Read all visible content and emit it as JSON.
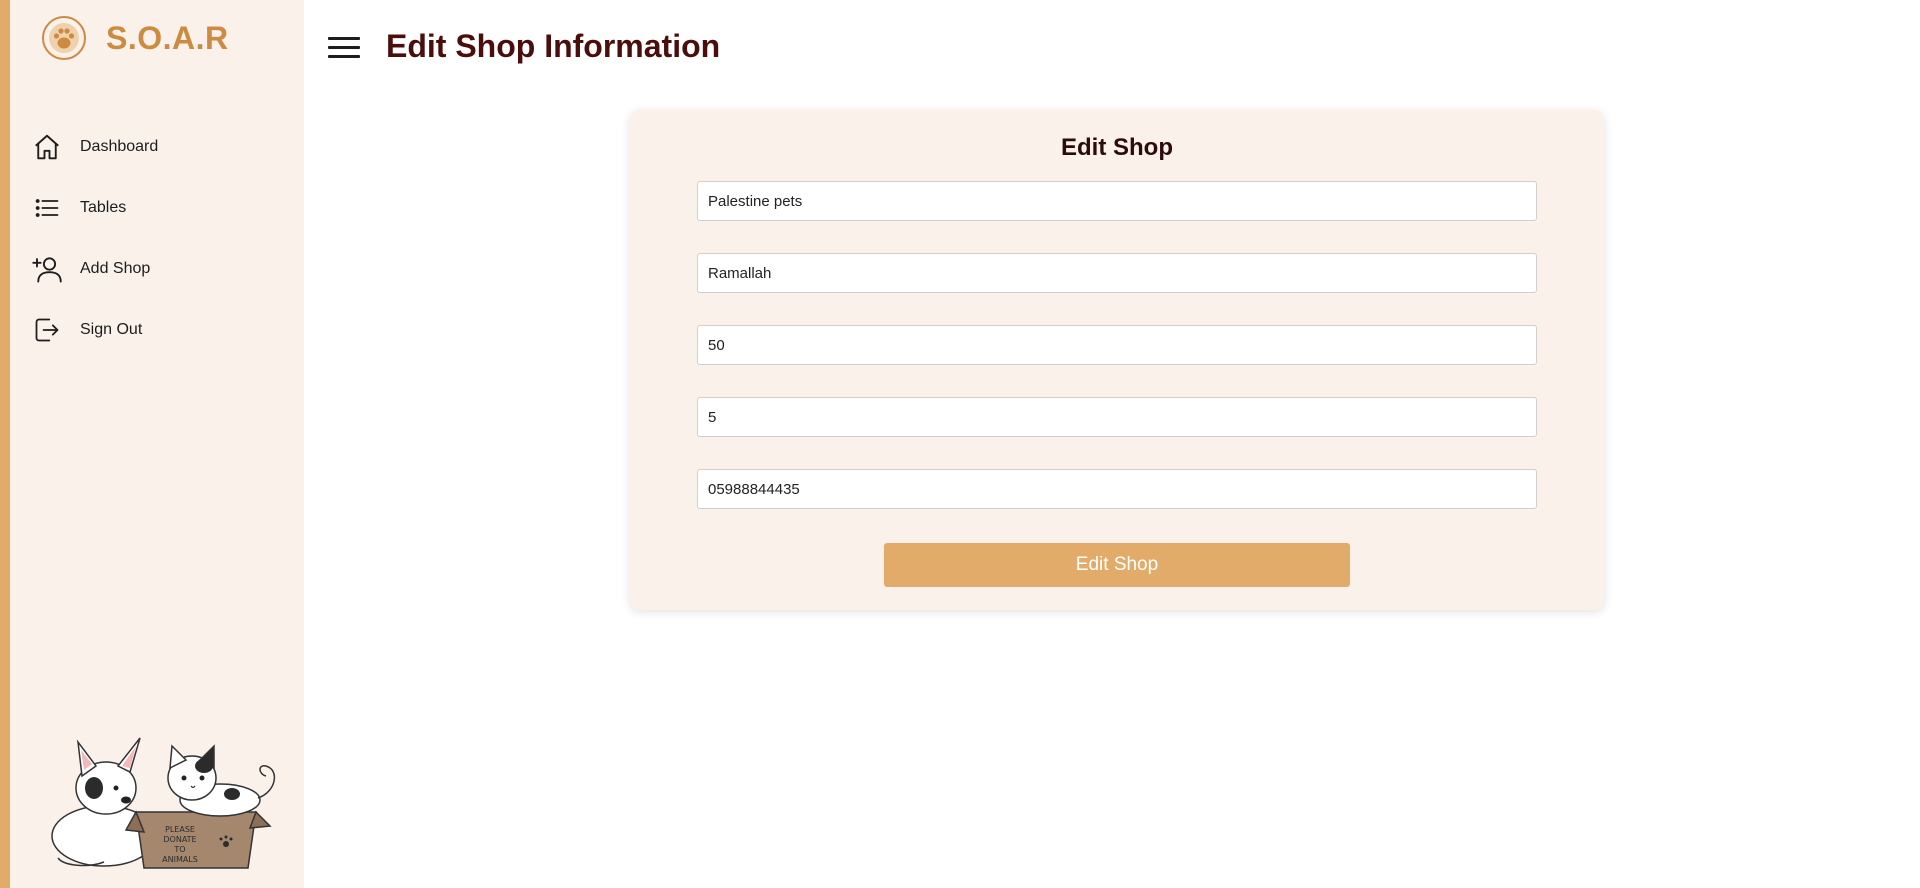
{
  "brand": {
    "name": "S.O.A.R",
    "logo_icon": "paw-logo-icon",
    "accent": "#cd8a41"
  },
  "sidebar": {
    "accent_color": "#e2ab6a",
    "background": "#f9f1ea",
    "items": [
      {
        "label": "Dashboard",
        "icon": "home-icon"
      },
      {
        "label": "Tables",
        "icon": "list-icon"
      },
      {
        "label": "Add Shop",
        "icon": "add-user-icon"
      },
      {
        "label": "Sign Out",
        "icon": "sign-out-icon"
      }
    ],
    "illustration": {
      "name": "pets-donation-illustration",
      "box_text": "PLEASE DONATE TO ANIMALS"
    }
  },
  "header": {
    "title": "Edit Shop Information",
    "menu_icon": "hamburger-menu-icon"
  },
  "form": {
    "title": "Edit Shop",
    "fields": [
      {
        "name": "shop-name",
        "value": "Palestine pets"
      },
      {
        "name": "shop-location",
        "value": "Ramallah"
      },
      {
        "name": "shop-field-3",
        "value": "50"
      },
      {
        "name": "shop-field-4",
        "value": "5"
      },
      {
        "name": "shop-phone",
        "value": "05988844435"
      }
    ],
    "submit_label": "Edit Shop",
    "button_color": "#e2ab6a"
  }
}
